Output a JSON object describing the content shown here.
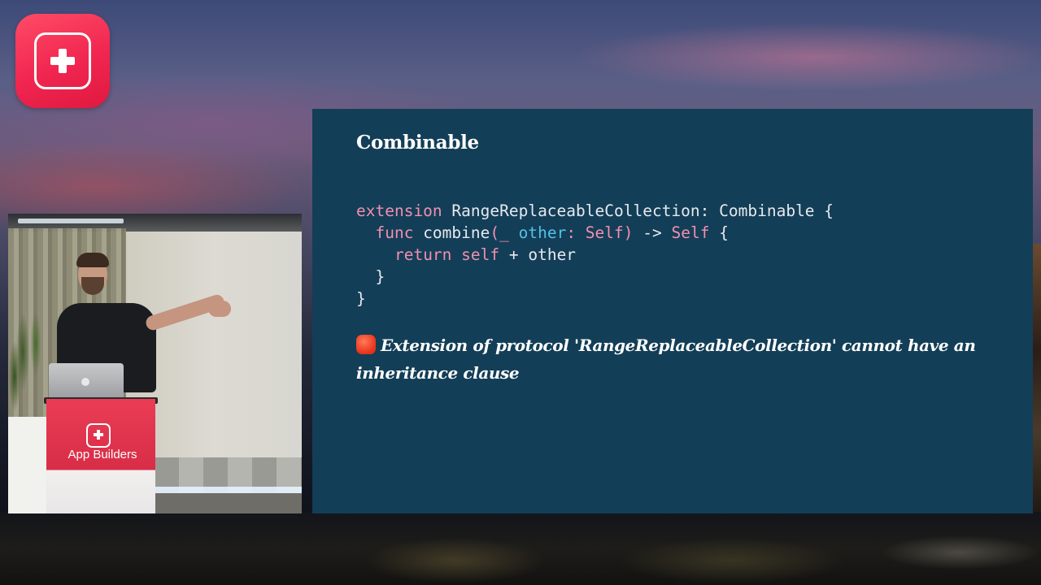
{
  "brand": {
    "accent": "#f02650",
    "name": "App Builders"
  },
  "slide": {
    "background": "#133e57",
    "title": "Combinable",
    "code": {
      "line1": {
        "kw_extension": "extension",
        "type": " RangeReplaceableCollection",
        "colon": ":",
        "protocol": " Combinable {"
      },
      "line2": {
        "indent": "  ",
        "kw_func": "func",
        "name": " combine",
        "paren_open": "(_ ",
        "param": "other",
        "colon_self": ": Self",
        "paren_close": ")",
        "arrow": " ->",
        "ret": " Self",
        "brace": " {"
      },
      "line3": {
        "indent": "    ",
        "kw_return": "return",
        "kw_self": " self",
        "rest": " + other"
      },
      "line4": "  }",
      "line5": "}"
    },
    "error_icon": "stop-icon",
    "error_message": "Extension of protocol 'RangeReplaceableCollection' cannot have an inheritance clause"
  },
  "video": {
    "podium_text": "App Builders"
  },
  "colors": {
    "keyword": "#f28fb0",
    "param": "#55c1e6",
    "plain": "#e7e9ee"
  }
}
